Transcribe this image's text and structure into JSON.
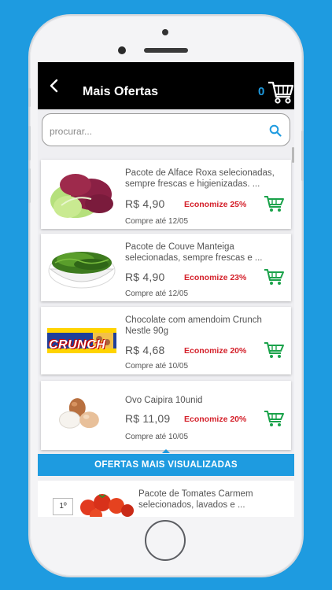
{
  "colors": {
    "accent": "#1e9be0",
    "discount": "#d4202a",
    "cart_green": "#1aa24a",
    "header_bg": "#000000"
  },
  "header": {
    "title": "Mais Ofertas",
    "cart_count": "0",
    "back_icon": "chevron-left-icon",
    "cart_icon": "shopping-cart-icon"
  },
  "search": {
    "placeholder": "procurar...",
    "icon": "search-icon"
  },
  "products": [
    {
      "name": "Pacote de Alface Roxa selecionadas, sempre frescas e higienizadas. ...",
      "price": "R$ 4,90",
      "discount": "Economize 25%",
      "until": "Compre até 12/05"
    },
    {
      "name": "Pacote de Couve Manteiga selecionadas, sempre frescas e ...",
      "price": "R$ 4,90",
      "discount": "Economize 23%",
      "until": "Compre até 12/05"
    },
    {
      "name": "Chocolate com amendoim Crunch Nestle 90g",
      "price": "R$ 4,68",
      "discount": "Economize 20%",
      "until": "Compre até 10/05"
    },
    {
      "name": "Ovo Caipira 10unid",
      "price": "R$ 11,09",
      "discount": "Economize 20%",
      "until": "Compre até 10/05"
    }
  ],
  "crunch_logo": "CRUNCH",
  "most_viewed": {
    "title": "OFERTAS MAIS VISUALIZADAS",
    "items": [
      {
        "rank": "1º",
        "name": "Pacote de Tomates Carmem selecionados, lavados e ..."
      }
    ]
  }
}
